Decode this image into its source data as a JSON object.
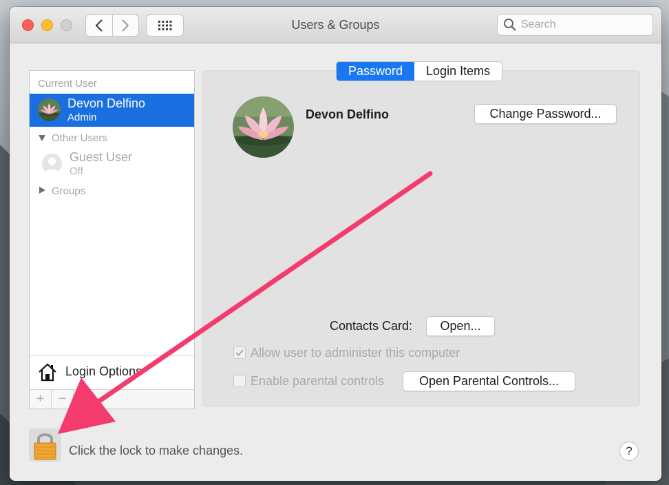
{
  "window": {
    "title": "Users & Groups"
  },
  "search": {
    "placeholder": "Search"
  },
  "sidebar": {
    "current_user_header": "Current User",
    "current_user": {
      "name": "Devon Delfino",
      "role": "Admin"
    },
    "other_users_header": "Other Users",
    "guest": {
      "name": "Guest User",
      "status": "Off"
    },
    "groups_header": "Groups",
    "login_options": "Login Options",
    "add_label": "+",
    "remove_label": "−"
  },
  "tabs": [
    {
      "label": "Password",
      "active": true
    },
    {
      "label": "Login Items",
      "active": false
    }
  ],
  "profile": {
    "name": "Devon Delfino",
    "change_password": "Change Password..."
  },
  "contacts": {
    "label": "Contacts Card:",
    "open_button": "Open..."
  },
  "options": {
    "admin_label": "Allow user to administer this computer",
    "admin_checked": true,
    "parental_label": "Enable parental controls",
    "parental_checked": false,
    "parental_button": "Open Parental Controls..."
  },
  "footer": {
    "lock_text": "Click the lock to make changes.",
    "help_label": "?"
  },
  "colors": {
    "selection": "#1a6fe0",
    "tab_active": "#1a77f2",
    "annotation_arrow": "#f43b6e"
  }
}
